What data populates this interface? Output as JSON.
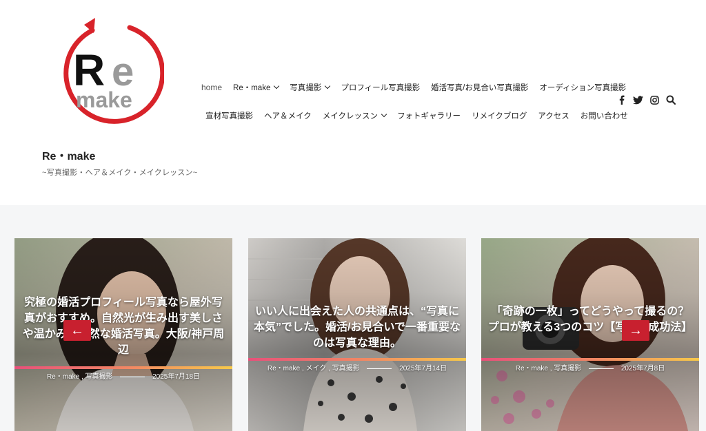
{
  "logo": {
    "text_re": "Re",
    "text_make": "make",
    "accent": "#d8232a"
  },
  "site": {
    "title": "Re・make",
    "description": "~写真撮影・ヘア＆メイク・メイクレッスン~"
  },
  "nav": {
    "row1": [
      {
        "label": "home",
        "dropdown": false
      },
      {
        "label": "Re・make",
        "dropdown": true
      },
      {
        "label": "写真撮影",
        "dropdown": true
      },
      {
        "label": "プロフィール写真撮影",
        "dropdown": false
      },
      {
        "label": "婚活写真/お見合い写真撮影",
        "dropdown": false
      },
      {
        "label": "オーディション写真撮影",
        "dropdown": false
      }
    ],
    "row2": [
      {
        "label": "宣材写真撮影",
        "dropdown": false
      },
      {
        "label": "ヘア＆メイク",
        "dropdown": false
      },
      {
        "label": "メイクレッスン",
        "dropdown": true
      },
      {
        "label": "フォトギャラリー",
        "dropdown": false
      },
      {
        "label": "リメイクブログ",
        "dropdown": false
      },
      {
        "label": "アクセス",
        "dropdown": false
      },
      {
        "label": "お問い合わせ",
        "dropdown": false
      }
    ]
  },
  "social": [
    "facebook-icon",
    "twitter-icon",
    "instagram-icon",
    "search-icon"
  ],
  "slider": {
    "prev_label": "←",
    "next_label": "→",
    "cards": [
      {
        "title": "究極の婚活プロフィール写真なら屋外写真がおすすめ。自然光が生み出す美しさや温かみ。自然な婚活写真。大阪/神戸周辺",
        "meta": "Re・make , 写真撮影",
        "date": "2025年7月18日"
      },
      {
        "title": "いい人に出会えた人の共通点は、“写真に本気”でした。婚活/お見合いで一番重要なのは写真な理由。",
        "meta": "Re・make , メイク , 写真撮影",
        "date": "2025年7月14日"
      },
      {
        "title": "「奇跡の一枚」ってどうやって撮るの？プロが教える3つのコツ【写真の成功法】",
        "meta": "Re・make , 写真撮影",
        "date": "2025年7月8日"
      }
    ]
  },
  "colors": {
    "accent_red": "#c8202f",
    "bar_start": "#e8507a",
    "bar_end": "#f7c94a",
    "content_bg": "#f5f6f7"
  }
}
